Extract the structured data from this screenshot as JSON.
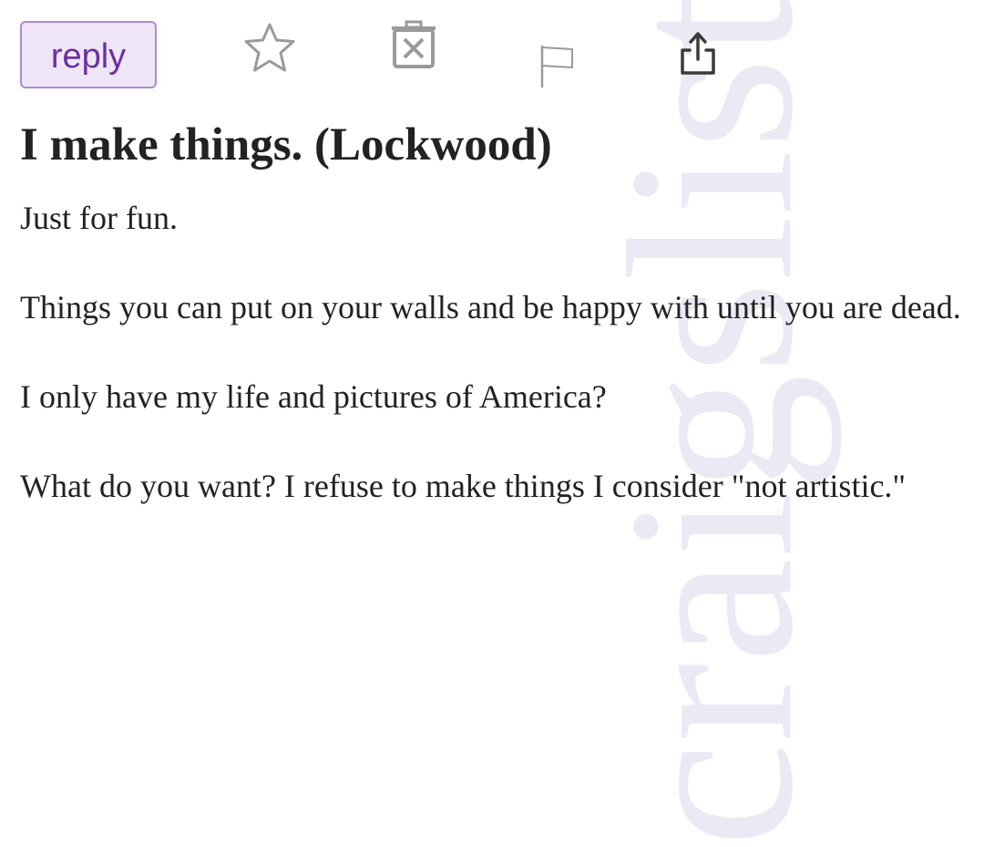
{
  "toolbar": {
    "reply_label": "reply",
    "icons": [
      "star-icon",
      "hide-icon",
      "flag-icon",
      "share-icon"
    ]
  },
  "posting": {
    "title": "I make things. (Lockwood)",
    "paragraphs": [
      "Just for fun.",
      "Things you can put on your walls and be happy with until you are dead.",
      "I only have my life and pictures of America?",
      "What do you want? I refuse to make things I consider \"not artistic.\""
    ]
  },
  "watermark": "craigslist",
  "colors": {
    "reply_text": "#6a2fa3",
    "reply_border": "#b088d6",
    "reply_bg": "#eee6f6",
    "icon_gray": "#9a9a9a",
    "watermark": "#ece8f4",
    "text": "#222222"
  }
}
